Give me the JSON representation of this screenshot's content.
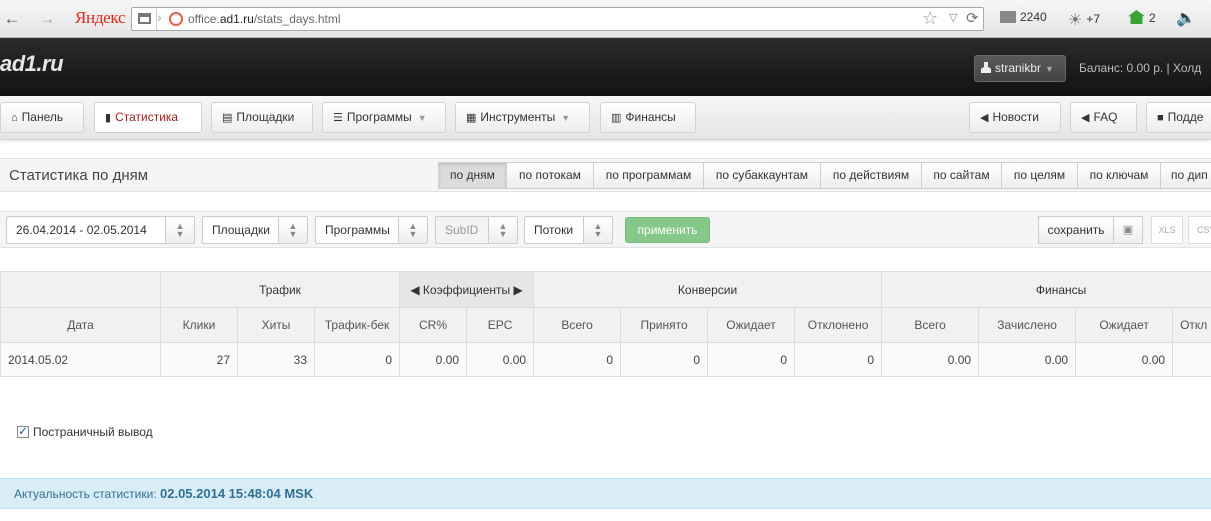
{
  "browser": {
    "brand": "Яндекс",
    "url_prefix": "office.",
    "url_domain": "ad1.ru",
    "url_path": "/stats_days.html",
    "mail_count": "2240",
    "weather": "+7",
    "notifications": "2"
  },
  "header": {
    "logo": "ad1.ru",
    "username": "stranikbr",
    "balance": "Баланс: 0.00 р.  |  Холд"
  },
  "nav": {
    "left": [
      "Панель",
      "Статистика",
      "Площадки",
      "Программы",
      "Инструменты",
      "Финансы"
    ],
    "right": [
      "Новости",
      "FAQ",
      "Подде"
    ]
  },
  "page": {
    "title": "Статистика по дням",
    "tabs": [
      "по дням",
      "по потокам",
      "по программам",
      "по субаккаунтам",
      "по действиям",
      "по сайтам",
      "по целям",
      "по ключам",
      "по дип"
    ]
  },
  "filters": {
    "date_range": "26.04.2014 - 02.05.2014",
    "sites": "Площадки",
    "programs": "Программы",
    "subid": "SubID",
    "streams": "Потоки",
    "apply": "применить",
    "save": "сохранить",
    "xls": "XLS",
    "csv": "CSV"
  },
  "table": {
    "groups": [
      "Трафик",
      "Коэффициенты",
      "Конверсии",
      "Финансы"
    ],
    "columns": [
      "Дата",
      "Клики",
      "Хиты",
      "Трафик-бек",
      "CR%",
      "EPC",
      "Всего",
      "Принято",
      "Ожидает",
      "Отклонено",
      "Всего",
      "Зачислено",
      "Ожидает",
      "Откл"
    ],
    "rows": [
      [
        "2014.05.02",
        "27",
        "33",
        "0",
        "0.00",
        "0.00",
        "0",
        "0",
        "0",
        "0",
        "0.00",
        "0.00",
        "0.00",
        ""
      ]
    ]
  },
  "paging_label": "Постраничный вывод",
  "actuality": {
    "label": "Актуальность статистики:",
    "value": "02.05.2014 15:48:04 MSK"
  }
}
